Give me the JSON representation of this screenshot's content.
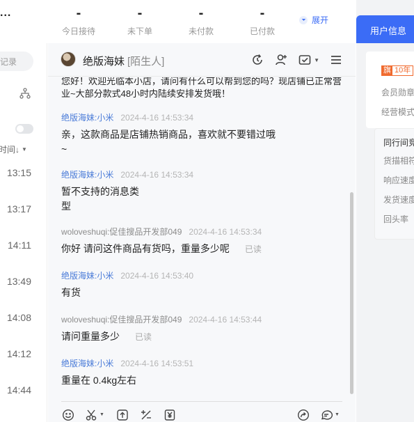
{
  "topbar": {
    "overflow_indicator": "...",
    "stats": [
      {
        "value": "-",
        "label": "今日接待"
      },
      {
        "value": "-",
        "label": "未下单"
      },
      {
        "value": "-",
        "label": "未付款"
      },
      {
        "value": "-",
        "label": "已付款"
      }
    ],
    "expand_label": "展开"
  },
  "left_panel": {
    "search_partial": "记录",
    "sort_label": "时间↓",
    "times": [
      "13:15",
      "13:17",
      "14:11",
      "13:49",
      "14:08",
      "14:12",
      "14:44"
    ]
  },
  "chat": {
    "title": "绝版海妹",
    "tag": "[陌生人]",
    "header_icons": [
      "refresh-icon",
      "add-user-icon",
      "task-check-icon",
      "menu-icon"
    ],
    "partial_message": "您好！欢迎光临本小店，请问有什么可以帮到您的吗？现店铺已正常营业~大部分款式48小时内陆续安排发货哦！",
    "messages": [
      {
        "sender": "绝版海妹:小米",
        "time": "2024-4-16 14:53:34",
        "text": "亲，这款商品是店铺热销商品，喜欢就不要错过哦~",
        "read": "",
        "role": "shop"
      },
      {
        "sender": "绝版海妹:小米",
        "time": "2024-4-16 14:53:34",
        "text": "暂不支持的消息类型",
        "read": "",
        "role": "shop"
      },
      {
        "sender": "woloveshuqi:促佳搜品开发部049",
        "time": "2024-4-16 14:53:34",
        "text": "你好 请问这件商品有货吗，重量多少呢",
        "read": "已读",
        "role": "buyer"
      },
      {
        "sender": "绝版海妹:小米",
        "time": "2024-4-16 14:53:40",
        "text": "有货",
        "read": "",
        "role": "shop"
      },
      {
        "sender": "woloveshuqi:促佳搜品开发部049",
        "time": "2024-4-16 14:53:44",
        "text": "请问重量多少",
        "read": "已读",
        "role": "buyer"
      },
      {
        "sender": "绝版海妹:小米",
        "time": "2024-4-16 14:53:51",
        "text": "重量在 0.4kg左右",
        "read": "",
        "role": "shop"
      }
    ],
    "toolbar_icons": [
      "emoji-icon",
      "scissors-icon",
      "upload-icon",
      "discount-icon",
      "coupon-icon",
      "share-icon",
      "quick-reply-icon"
    ]
  },
  "right_panel": {
    "tab_label": "用户信息",
    "badge_icon": "旗",
    "badge_years": "10年",
    "labels": [
      "会员勋章",
      "经营模式"
    ],
    "peer_title": "同行间竞",
    "peer_items": [
      "货描相符",
      "响应速度",
      "发货速度",
      "回头率"
    ]
  },
  "colors": {
    "accent": "#3b6cf6",
    "shop_sender": "#4a7bd8",
    "badge": "#f06a2e"
  }
}
